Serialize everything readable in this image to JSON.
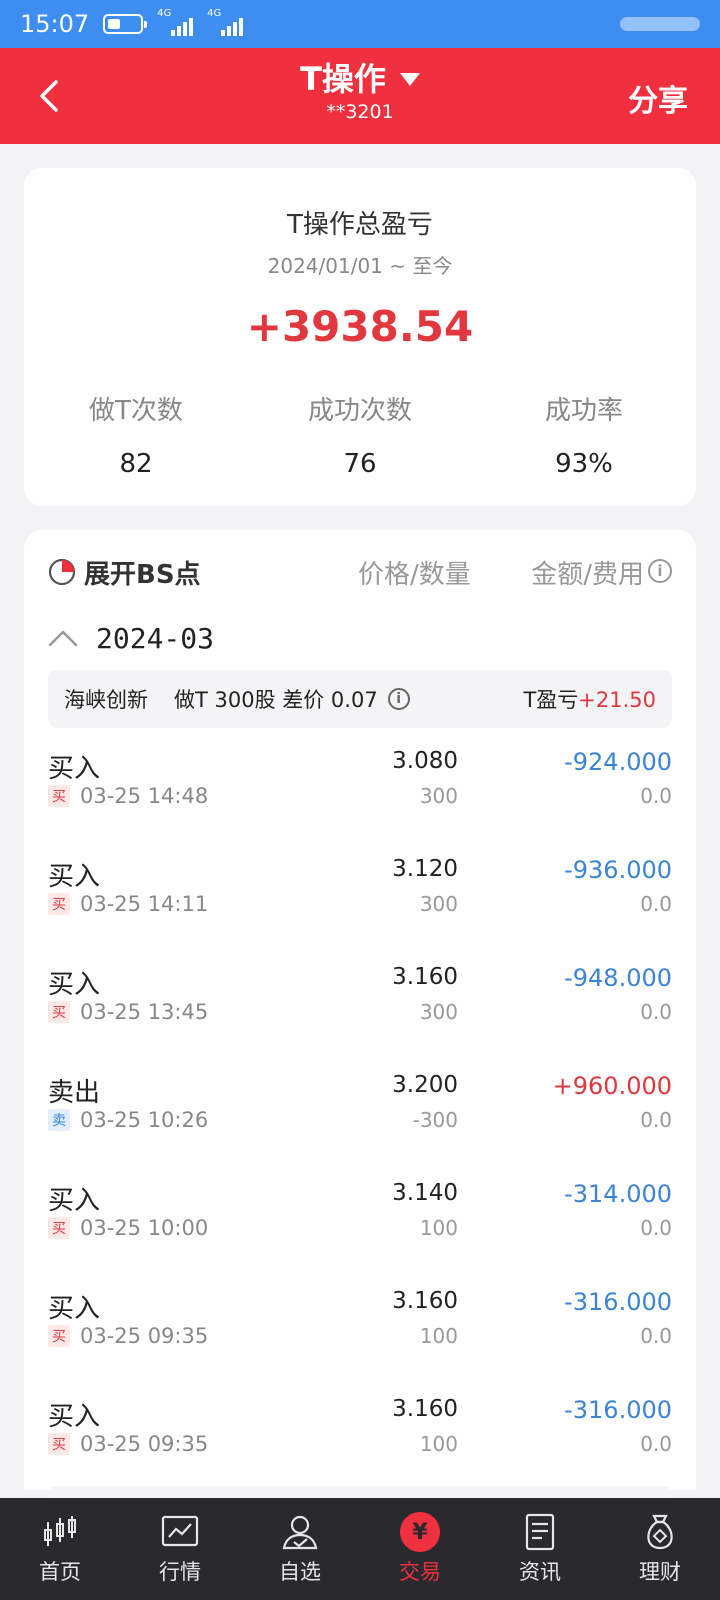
{
  "status_bar": {
    "time": "15:07",
    "net1": "4G",
    "net2": "4G"
  },
  "header": {
    "title": "T操作",
    "account": "**3201",
    "share": "分享"
  },
  "summary": {
    "title": "T操作总盈亏",
    "range": "2024/01/01 ~ 至今",
    "total": "+3938.54",
    "stats": [
      {
        "label": "做T次数",
        "value": "82"
      },
      {
        "label": "成功次数",
        "value": "76"
      },
      {
        "label": "成功率",
        "value": "93%"
      }
    ]
  },
  "list": {
    "expand_label": "展开BS点",
    "col_price": "价格/数量",
    "col_amount": "金额/费用",
    "info_glyph": "i",
    "month": "2024-03",
    "stock": {
      "name": "海峡创新",
      "desc": "做T 300股 差价 0.07",
      "pl_label": "T盈亏",
      "pl_value": "+21.50"
    },
    "rows": [
      {
        "type": "买入",
        "badge": "买",
        "time": "03-25 14:48",
        "price": "3.080",
        "qty": "300",
        "amount": "-924.000",
        "fee": "0.0"
      },
      {
        "type": "买入",
        "badge": "买",
        "time": "03-25 14:11",
        "price": "3.120",
        "qty": "300",
        "amount": "-936.000",
        "fee": "0.0"
      },
      {
        "type": "买入",
        "badge": "买",
        "time": "03-25 13:45",
        "price": "3.160",
        "qty": "300",
        "amount": "-948.000",
        "fee": "0.0"
      },
      {
        "type": "卖出",
        "badge": "卖",
        "time": "03-25 10:26",
        "price": "3.200",
        "qty": "-300",
        "amount": "+960.000",
        "fee": "0.0"
      },
      {
        "type": "买入",
        "badge": "买",
        "time": "03-25 10:00",
        "price": "3.140",
        "qty": "100",
        "amount": "-314.000",
        "fee": "0.0"
      },
      {
        "type": "买入",
        "badge": "买",
        "time": "03-25 09:35",
        "price": "3.160",
        "qty": "100",
        "amount": "-316.000",
        "fee": "0.0"
      },
      {
        "type": "买入",
        "badge": "买",
        "time": "03-25 09:35",
        "price": "3.160",
        "qty": "100",
        "amount": "-316.000",
        "fee": "0.0"
      }
    ]
  },
  "tabbar": {
    "yen_glyph": "¥",
    "tabs": [
      {
        "label": "首页",
        "icon": "candlestick-icon"
      },
      {
        "label": "行情",
        "icon": "chart-icon"
      },
      {
        "label": "自选",
        "icon": "user-check-icon"
      },
      {
        "label": "交易",
        "icon": "yen-icon"
      },
      {
        "label": "资讯",
        "icon": "document-icon"
      },
      {
        "label": "理财",
        "icon": "money-bag-icon"
      }
    ]
  },
  "colors": {
    "brand_red": "#f0303e",
    "status_blue": "#3d8ef0",
    "gain_red": "#e3373f",
    "loss_blue": "#3b84d8"
  }
}
